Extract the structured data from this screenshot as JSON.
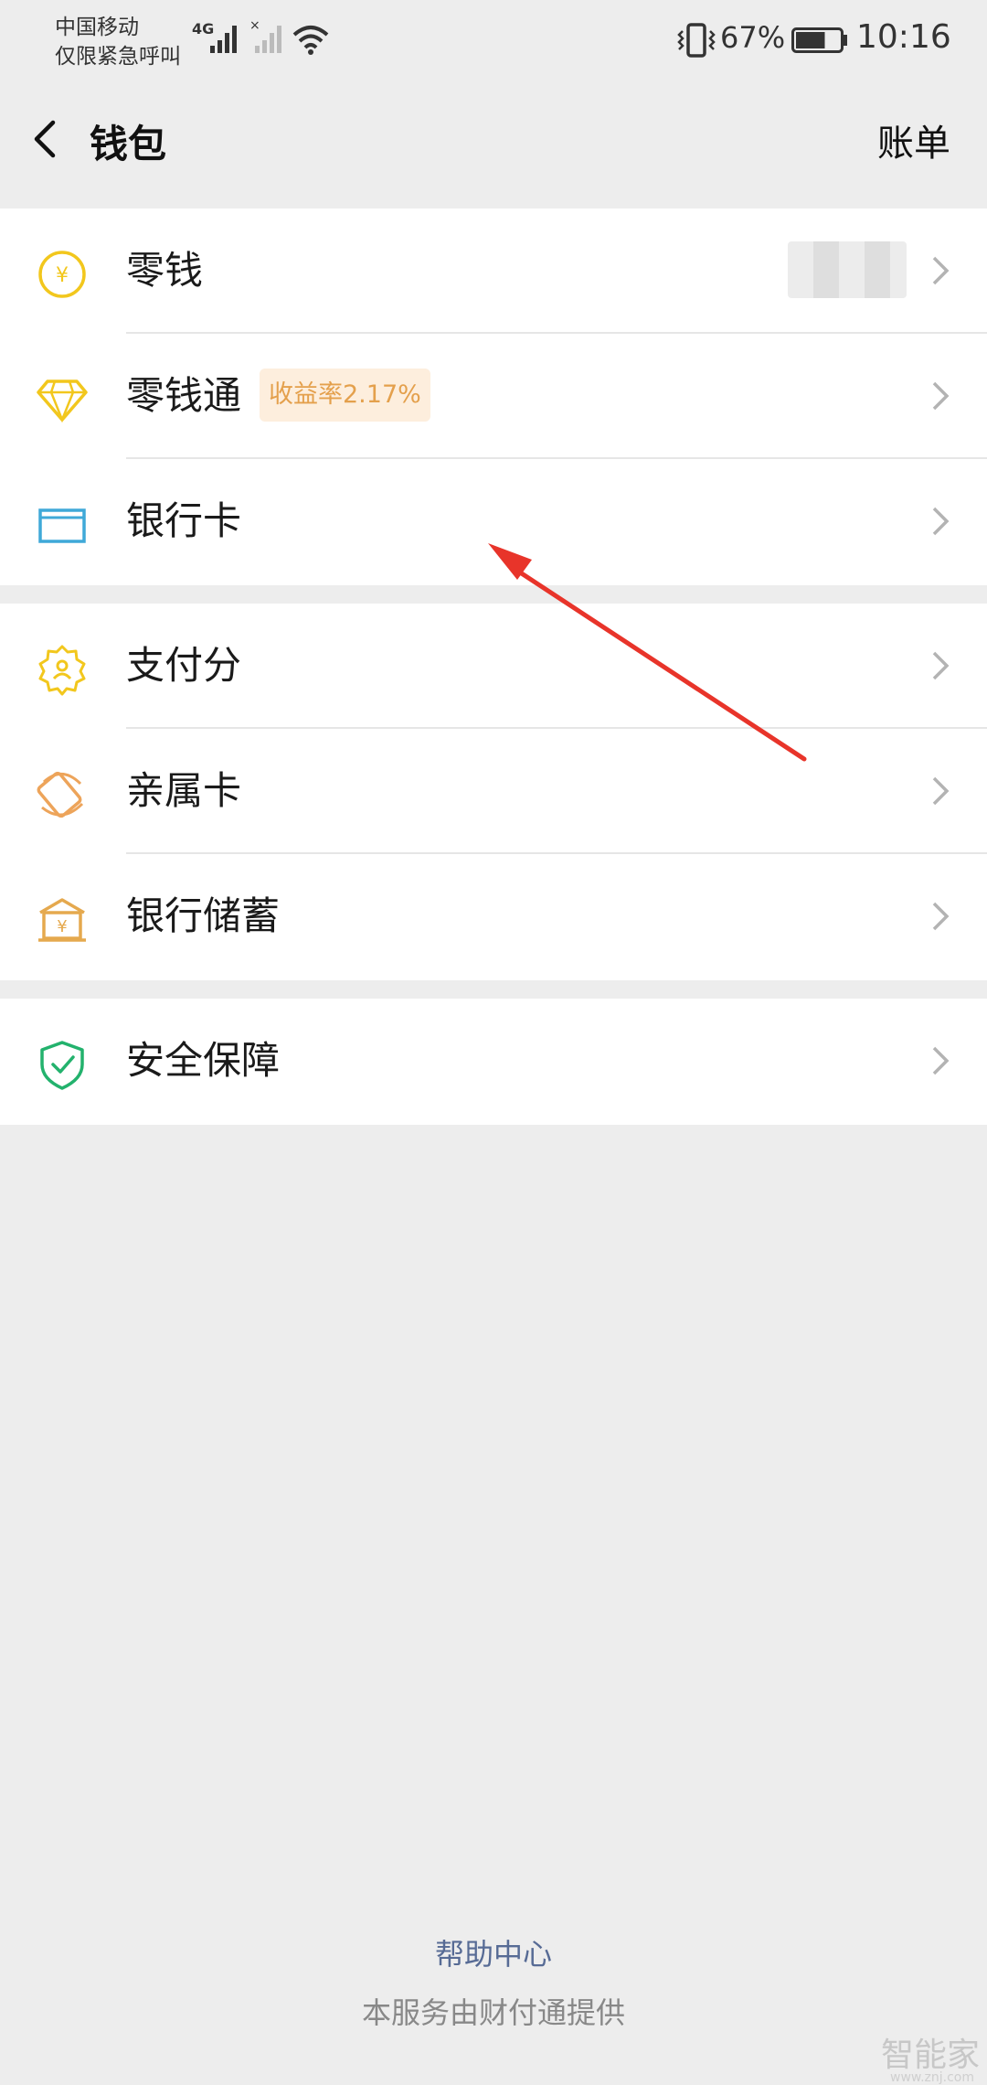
{
  "status_bar": {
    "carrier_line1": "中国移动",
    "carrier_line2": "仅限紧急呼叫",
    "network": "4G",
    "battery_percent": "67%",
    "battery_level": 0.67,
    "time": "10:16"
  },
  "nav": {
    "back_icon": "chevron-left-icon",
    "title": "钱包",
    "right_action": "账单"
  },
  "groups": [
    {
      "items": [
        {
          "label": "零钱",
          "icon": "yuan-coin-icon",
          "value_blurred": true
        },
        {
          "label": "零钱通",
          "icon": "diamond-icon",
          "badge": "收益率2.17%"
        },
        {
          "label": "银行卡",
          "icon": "bank-card-icon"
        }
      ]
    },
    {
      "items": [
        {
          "label": "支付分",
          "icon": "payscore-badge-icon"
        },
        {
          "label": "亲属卡",
          "icon": "family-card-icon"
        },
        {
          "label": "银行储蓄",
          "icon": "bank-savings-icon"
        }
      ]
    },
    {
      "items": [
        {
          "label": "安全保障",
          "icon": "shield-check-icon"
        }
      ]
    }
  ],
  "footer": {
    "help": "帮助中心",
    "provider": "本服务由财付通提供"
  },
  "watermark": {
    "text": "智能家",
    "sub": "www.znj.com"
  },
  "colors": {
    "background": "#ededed",
    "link": "#576b95",
    "badge_text": "#e4a04c",
    "badge_bg": "#fdeedd",
    "annotation_arrow": "#e8342a"
  }
}
